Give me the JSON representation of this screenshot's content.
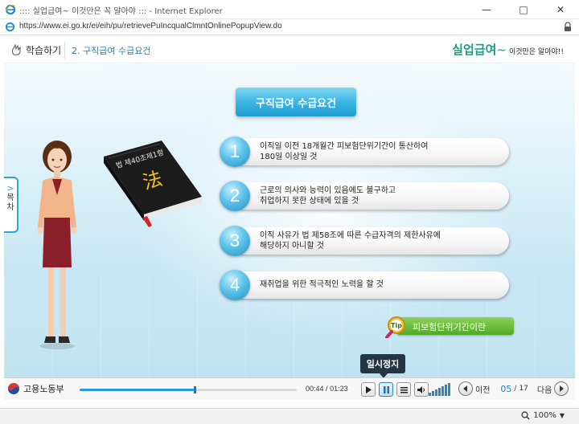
{
  "window": {
    "title": ":::: 실업급여~ 이것만은 꼭 알아야 ::: - Internet Explorer",
    "minimize": "—",
    "maximize": "□",
    "close": "✕"
  },
  "address": {
    "url": "https://www.ei.go.kr/ei/eih/pu/retrievePuIncqualClmntOnlinePopupView.do"
  },
  "header": {
    "learn_label": "학습하기",
    "breadcrumb": "2. 구직급여 수급요건",
    "brand_main": "실업급여",
    "brand_tilde": "~",
    "brand_sub": "이것만은 알아야!!"
  },
  "book": {
    "spine_label": "법 제40조제1항",
    "symbol": "法"
  },
  "main": {
    "title": "구직급여 수급요건",
    "requirements": [
      {
        "num": "1",
        "text": "이직일 이전 18개월간 피보험단위기간이 통산하여\n180일 이상일 것"
      },
      {
        "num": "2",
        "text": "근로의 의사와 능력이 있음에도 불구하고\n취업하지 못한 상태에 있을 것"
      },
      {
        "num": "3",
        "text": "이직 사유가 법 제58조에 따른 수급자격의 제한사유에\n해당하지 아니할 것"
      },
      {
        "num": "4",
        "text": "재취업을 위한 적극적인 노력을 할 것"
      }
    ],
    "tip_badge": "Tip",
    "tip_label": "피보험단위기간이란"
  },
  "toc": {
    "arrow": ">",
    "label_1": "목",
    "label_2": "차"
  },
  "player": {
    "org": "고용노동부",
    "current_time": "00:44",
    "total_time": "01:23",
    "progress": 0.53,
    "tooltip": "일시정지",
    "prev_label": "이전",
    "next_label": "다음",
    "page_current": "05",
    "page_sep": "/",
    "page_total": "17"
  },
  "status": {
    "zoom": "100%"
  },
  "colors": {
    "accent": "#2aa7d6",
    "brand": "#1a9c88",
    "tip_green": "#4fa82a"
  }
}
